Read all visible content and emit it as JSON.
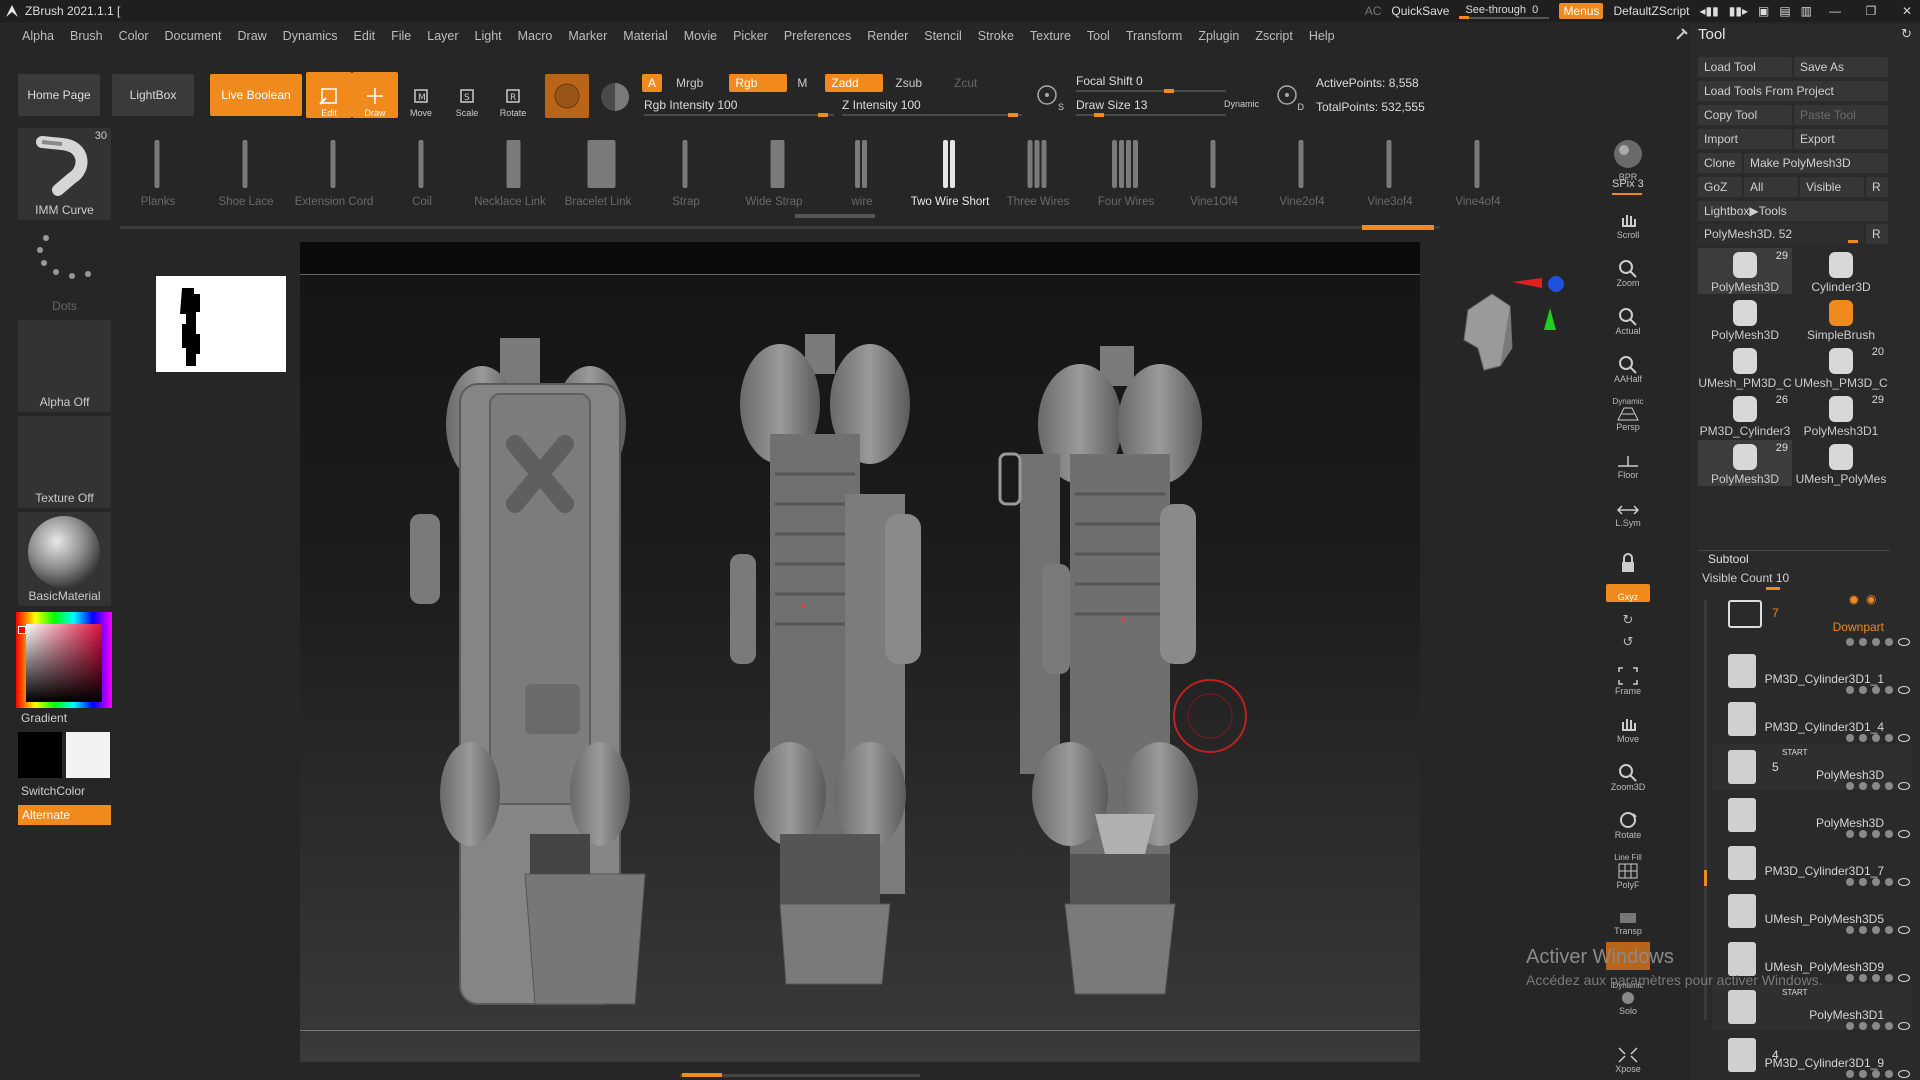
{
  "titlebar": {
    "app_title": "ZBrush 2021.1.1 [",
    "ac": "AC",
    "quicksave": "QuickSave",
    "see_through_label": "See-through",
    "see_through_value": "0",
    "see_through_level": 0,
    "menus": "Menus",
    "default_zscript": "DefaultZScript"
  },
  "menubar": [
    "Alpha",
    "Brush",
    "Color",
    "Document",
    "Draw",
    "Dynamics",
    "Edit",
    "File",
    "Layer",
    "Light",
    "Macro",
    "Marker",
    "Material",
    "Movie",
    "Picker",
    "Preferences",
    "Render",
    "Stencil",
    "Stroke",
    "Texture",
    "Tool",
    "Transform",
    "Zplugin",
    "Zscript",
    "Help"
  ],
  "toptool": {
    "home_page": "Home Page",
    "lightbox": "LightBox",
    "live_boolean": "Live Boolean",
    "edit": "Edit",
    "draw": "Draw",
    "move": "Move",
    "scale": "Scale",
    "rotate": "Rotate",
    "a": "A",
    "mrgb": "Mrgb",
    "rgb": "Rgb",
    "m": "M",
    "zadd": "Zadd",
    "zsub": "Zsub",
    "zcut": "Zcut",
    "rgb_intensity": "Rgb Intensity 100",
    "z_intensity": "Z Intensity 100",
    "focal_shift": "Focal Shift 0",
    "draw_size": "Draw Size 13",
    "dynamic": "Dynamic",
    "s": "S",
    "d": "D",
    "active_points": "ActivePoints: 8,558",
    "total_points": "TotalPoints: 532,555"
  },
  "brushes": [
    {
      "label": "Planks",
      "selected": false
    },
    {
      "label": "Shoe Lace",
      "selected": false
    },
    {
      "label": "Extension Cord",
      "selected": false
    },
    {
      "label": "Coil",
      "selected": false
    },
    {
      "label": "Necklace Link",
      "selected": false
    },
    {
      "label": "Bracelet Link",
      "selected": false
    },
    {
      "label": "Strap",
      "selected": false
    },
    {
      "label": "Wide Strap",
      "selected": false
    },
    {
      "label": "wire",
      "selected": false
    },
    {
      "label": "Two Wire Short",
      "selected": true
    },
    {
      "label": "Three Wires",
      "selected": false
    },
    {
      "label": "Four Wires",
      "selected": false
    },
    {
      "label": "Vine1Of4",
      "selected": false
    },
    {
      "label": "Vine2of4",
      "selected": false
    },
    {
      "label": "Vine3of4",
      "selected": false
    },
    {
      "label": "Vine4of4",
      "selected": false
    }
  ],
  "leftshelf": {
    "imm_curve": "IMM Curve",
    "imm_count": "30",
    "dots": "Dots",
    "alpha_off": "Alpha Off",
    "texture_off": "Texture Off",
    "basic_material": "BasicMaterial",
    "gradient": "Gradient",
    "switch_color": "SwitchColor",
    "alternate": "Alternate"
  },
  "rightbar": {
    "bpr": "BPR",
    "spix": "SPix 3",
    "scroll": "Scroll",
    "zoom": "Zoom",
    "actual": "Actual",
    "aahalf": "AAHalf",
    "dynamic": "Dynamic",
    "persp": "Persp",
    "floor": "Floor",
    "lsym": "L.Sym",
    "gxyz": "Gxyz",
    "frame": "Frame",
    "move": "Move",
    "zoom3d": "Zoom3D",
    "rotate": "Rotate",
    "line_fill": "Line Fill",
    "polyf": "PolyF",
    "transp": "Transp",
    "dynamic2": "Dynamic",
    "solo": "Solo",
    "xpose": "Xpose"
  },
  "toolpanel": {
    "title": "Tool",
    "load_tool": "Load Tool",
    "save_as": "Save As",
    "load_from_project": "Load Tools From Project",
    "copy_tool": "Copy Tool",
    "paste_tool": "Paste Tool",
    "import": "Import",
    "export": "Export",
    "clone": "Clone",
    "make_polymesh": "Make PolyMesh3D",
    "goz": "GoZ",
    "all": "All",
    "visible": "Visible",
    "r": "R",
    "lightbox_tools": "Lightbox▶Tools",
    "polymesh_slider": "PolyMesh3D. 52",
    "thumbs": [
      {
        "label": "PolyMesh3D",
        "num": "29",
        "selected": true
      },
      {
        "label": "Cylinder3D",
        "num": "",
        "selected": false
      },
      {
        "label": "PolyMesh3D",
        "num": "",
        "selected": false
      },
      {
        "label": "SimpleBrush",
        "num": "",
        "selected": false
      },
      {
        "label": "UMesh_PM3D_C",
        "num": "",
        "selected": false
      },
      {
        "label": "UMesh_PM3D_C",
        "num": "20",
        "selected": false
      },
      {
        "label": "PM3D_Cylinder3",
        "num": "26",
        "selected": false
      },
      {
        "label": "PolyMesh3D1",
        "num": "29",
        "selected": false
      },
      {
        "label": "PolyMesh3D",
        "num": "29",
        "selected": true
      },
      {
        "label": "UMesh_PolyMes",
        "num": "",
        "selected": false
      }
    ],
    "subtool": "Subtool",
    "visible_count": "Visible Count 10",
    "subtools": [
      {
        "name": "Downpart",
        "count": "7",
        "highlight": true
      },
      {
        "name": "PM3D_Cylinder3D1_1"
      },
      {
        "name": "PM3D_Cylinder3D1_4"
      },
      {
        "name": "PolyMesh3D",
        "count": "5",
        "start": "START"
      },
      {
        "name": "PolyMesh3D"
      },
      {
        "name": "PM3D_Cylinder3D1_7"
      },
      {
        "name": "UMesh_PolyMesh3D5"
      },
      {
        "name": "UMesh_PolyMesh3D9"
      },
      {
        "name": "PolyMesh3D1",
        "start": "START"
      },
      {
        "name": "PM3D_Cylinder3D1_9",
        "count": "4"
      }
    ]
  },
  "watermark": {
    "line1": "Activer Windows",
    "line2": "Accédez aux paramètres pour activer Windows."
  },
  "colors": {
    "accent": "#f08a1c",
    "bg": "#262626",
    "panel": "#2a2a2a"
  }
}
